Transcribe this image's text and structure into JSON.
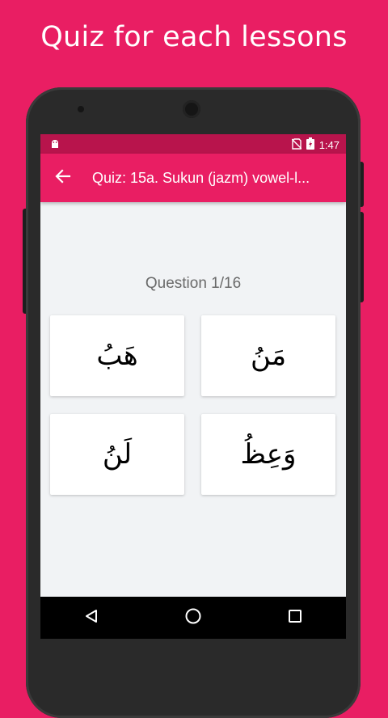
{
  "promo": {
    "headline": "Quiz for each lessons"
  },
  "status_bar": {
    "time": "1:47"
  },
  "app_bar": {
    "title": "Quiz: 15a. Sukun (jazm) vowel-l..."
  },
  "quiz": {
    "question_label": "Question 1/16",
    "options": [
      {
        "text": "هَبُ"
      },
      {
        "text": "مَنُ"
      },
      {
        "text": "لَنُ"
      },
      {
        "text": "وَعِظُ"
      }
    ]
  },
  "colors": {
    "accent": "#e91e63",
    "status_bar": "#b8144c",
    "screen_bg": "#f1f3f5"
  },
  "icons": {
    "back": "arrow-left-icon",
    "status": [
      "android-icon",
      "no-sim-icon",
      "battery-charging-icon"
    ],
    "nav": [
      "back-triangle-icon",
      "home-circle-icon",
      "recents-square-icon"
    ]
  }
}
